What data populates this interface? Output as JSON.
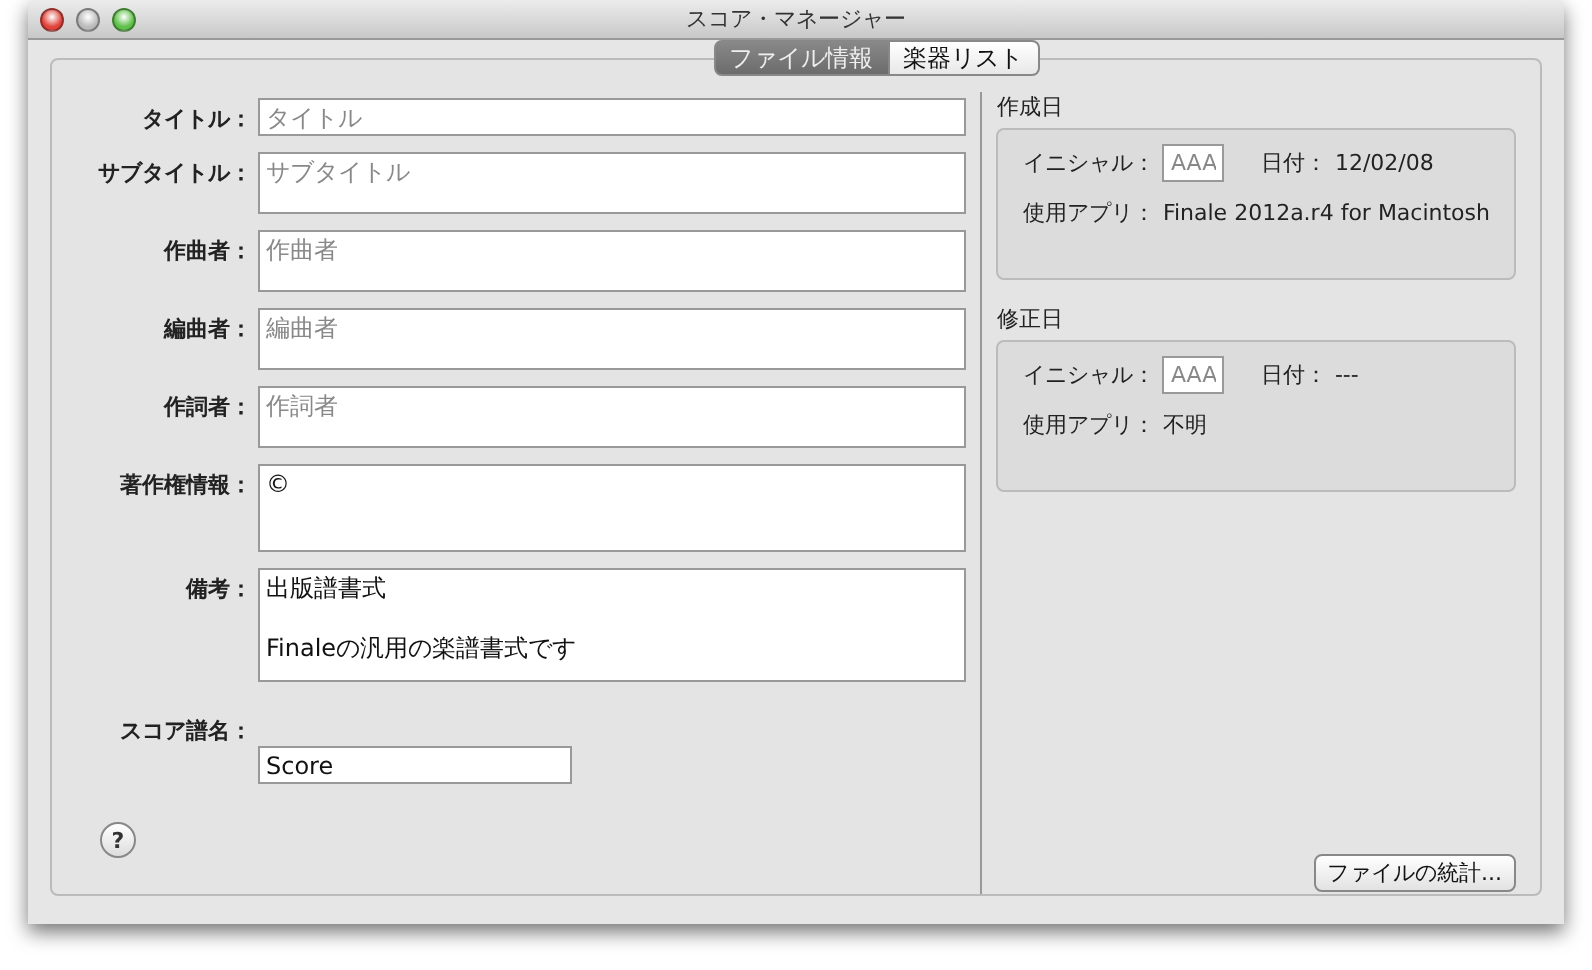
{
  "window": {
    "title": "スコア・マネージャー"
  },
  "tabs": [
    {
      "label": "ファイル情報",
      "selected": true
    },
    {
      "label": "楽器リスト",
      "selected": false
    }
  ],
  "fields": [
    {
      "label": "タイトル：",
      "kind": "line",
      "placeholder": "タイトル"
    },
    {
      "label": "サブタイトル：",
      "kind": "box",
      "placeholder": "サブタイトル"
    },
    {
      "label": "作曲者：",
      "kind": "box",
      "placeholder": "作曲者"
    },
    {
      "label": "編曲者：",
      "kind": "box",
      "placeholder": "編曲者"
    },
    {
      "label": "作詞者：",
      "kind": "box",
      "placeholder": "作詞者"
    },
    {
      "label": "著作権情報：",
      "kind": "tall",
      "value": "©"
    },
    {
      "label": "備考：",
      "kind": "taller",
      "value": "出版譜書式\n\nFinaleの汎用の楽譜書式です"
    },
    {
      "label": "スコア譜名：",
      "kind": "short",
      "value": "Score"
    }
  ],
  "groups": [
    {
      "title": "作成日",
      "initials_label": "イニシャル：",
      "initials_placeholder": "AAA",
      "date_label": "日付：",
      "date": "12/02/08",
      "app_label": "使用アプリ：",
      "app": "Finale 2012a.r4 for Macintosh"
    },
    {
      "title": "修正日",
      "initials_label": "イニシャル：",
      "initials_placeholder": "AAA",
      "date_label": "日付：",
      "date": "---",
      "app_label": "使用アプリ：",
      "app": "不明"
    }
  ],
  "help_button": "?",
  "stats_button": "ファイルの統計..."
}
